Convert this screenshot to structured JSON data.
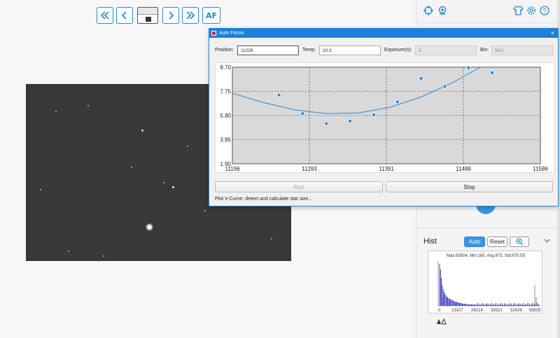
{
  "nav": {
    "first_icon": "double-chevron-left-icon",
    "prev_icon": "chevron-left-icon",
    "next_icon": "chevron-right-icon",
    "last_icon": "double-chevron-right-icon",
    "af_label": "AF"
  },
  "dialog": {
    "title": "Auto Focus",
    "close_glyph": "×",
    "position_label": "Position:",
    "position_value": "11226",
    "temp_label": "Temp:",
    "temp_value": "10.3",
    "exposure_label": "Exposure(s):",
    "exposure_value": "3",
    "bin_label": "Bin:",
    "bin_value": "Bin1",
    "run_label": "Run",
    "stop_label": "Stop",
    "status_text": "Plot V-Curve: detect and calculate star size..."
  },
  "chart_data": {
    "type": "scatter",
    "x_ticks": [
      "11196",
      "11293",
      "11391",
      "11488",
      "11586"
    ],
    "y_ticks": [
      "9.70",
      "7.75",
      "5.80",
      "3.85",
      "1.90"
    ],
    "xlim": [
      11196,
      11586
    ],
    "ylim": [
      1.9,
      9.7
    ],
    "points": [
      {
        "x": 11255,
        "y": 7.45
      },
      {
        "x": 11285,
        "y": 5.95
      },
      {
        "x": 11315,
        "y": 5.15
      },
      {
        "x": 11345,
        "y": 5.35
      },
      {
        "x": 11375,
        "y": 5.85
      },
      {
        "x": 11405,
        "y": 6.9
      },
      {
        "x": 11435,
        "y": 8.8
      },
      {
        "x": 11465,
        "y": 8.15
      },
      {
        "x": 11495,
        "y": 9.65
      },
      {
        "x": 11525,
        "y": 9.25
      }
    ],
    "fit_curve": [
      {
        "x": 11196,
        "y": 7.6
      },
      {
        "x": 11235,
        "y": 6.85
      },
      {
        "x": 11275,
        "y": 6.25
      },
      {
        "x": 11315,
        "y": 5.95
      },
      {
        "x": 11355,
        "y": 6.0
      },
      {
        "x": 11395,
        "y": 6.45
      },
      {
        "x": 11435,
        "y": 7.3
      },
      {
        "x": 11475,
        "y": 8.45
      },
      {
        "x": 11510,
        "y": 9.7
      }
    ],
    "point_color": "#2b8ad6",
    "curve_color": "#2b8ad6",
    "grid": true
  },
  "hist": {
    "title": "Hist",
    "auto_label": "Auto",
    "reset_label": "Reset",
    "zoom_icon": "zoom-in-icon",
    "stats": "Max:65504, Min:160, Avg:873, Std:670.55",
    "ticks": [
      "0",
      "13107",
      "26214",
      "39321",
      "52428",
      "65535"
    ],
    "collapse_icon": "chevron-down-icon"
  },
  "right_panel": {
    "icons": [
      "crosshair-icon",
      "camera-icon",
      "shirt-icon",
      "gear-icon",
      "help-icon"
    ]
  }
}
